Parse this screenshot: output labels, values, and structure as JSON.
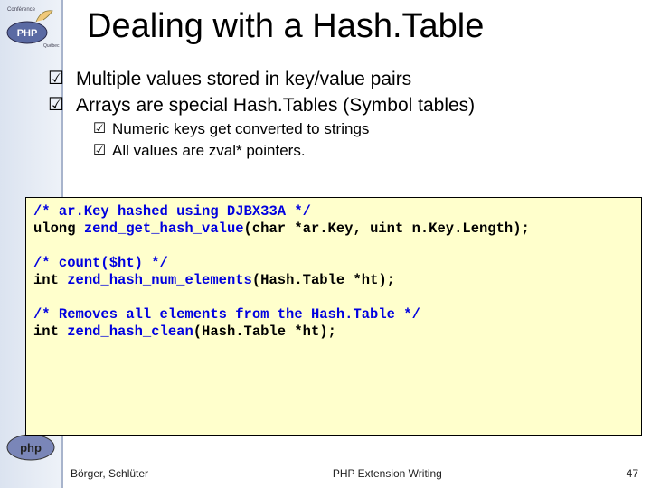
{
  "title": "Dealing with a Hash.Table",
  "bullets": {
    "b1": "Multiple values stored in key/value pairs",
    "b2": "Arrays are special Hash.Tables (Symbol tables)",
    "s1": "Numeric keys get converted to strings",
    "s2": "All values are zval* pointers."
  },
  "code": {
    "c1": "/* ar.Key hashed using DJBX33A */",
    "l1a": "ulong ",
    "l1b": "zend_get_hash_value",
    "l1c": "(char *ar.Key, uint n.Key.Length);",
    "c2": "/* count($ht) */",
    "l2a": "int ",
    "l2b": "zend_hash_num_elements",
    "l2c": "(Hash.Table *ht);",
    "c3": "/* Removes all elements from the Hash.Table */",
    "l3a": "int ",
    "l3b": "zend_hash_clean",
    "l3c": "(Hash.Table *ht);"
  },
  "footer": {
    "left": "Börger, Schlüter",
    "center": "PHP Extension Writing",
    "right": "47"
  },
  "logos": {
    "top": "conference-php-quebec-logo",
    "bottom": "php-logo"
  }
}
